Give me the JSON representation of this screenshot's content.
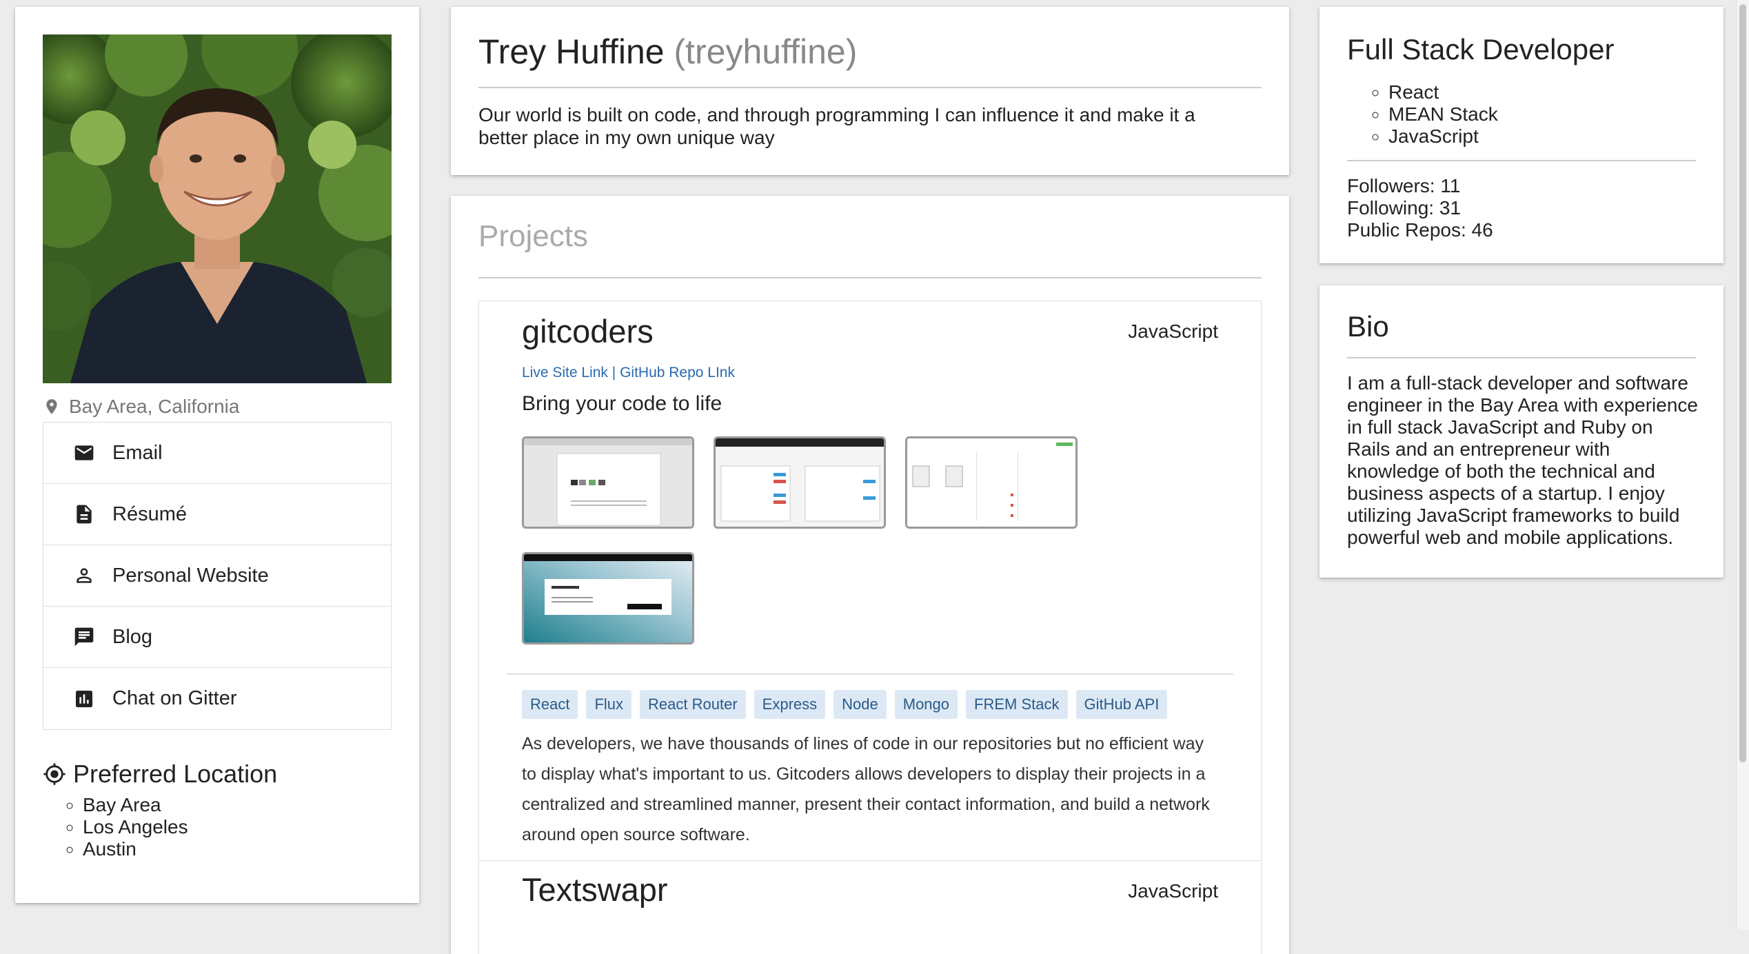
{
  "profile": {
    "name": "Trey Huffine",
    "username": "(treyhuffine)",
    "tagline": "Our world is built on code, and through programming I can influence it and make it a better place in my own unique way",
    "location": "Bay Area, California"
  },
  "links": [
    {
      "label": "Email",
      "icon": "email-icon"
    },
    {
      "label": "Résumé",
      "icon": "document-icon"
    },
    {
      "label": "Personal Website",
      "icon": "person-icon"
    },
    {
      "label": "Blog",
      "icon": "chat-bubble-icon"
    },
    {
      "label": "Chat on Gitter",
      "icon": "bar-chart-icon"
    }
  ],
  "preferred_location": {
    "title": "Preferred Location",
    "items": [
      "Bay Area",
      "Los Angeles",
      "Austin"
    ]
  },
  "projects": {
    "title": "Projects",
    "items": [
      {
        "name": "gitcoders",
        "language": "JavaScript",
        "live_link": "Live Site Link",
        "separator": "|",
        "repo_link": "GitHub Repo LInk",
        "tagline": "Bring your code to life",
        "tags": [
          "React",
          "Flux",
          "React Router",
          "Express",
          "Node",
          "Mongo",
          "FREM Stack",
          "GitHub API"
        ],
        "description": "As developers, we have thousands of lines of code in our repositories but no efficient way to display what's important to us. Gitcoders allows developers to display their projects in a centralized and streamlined manner, present their contact information, and build a network around open source software."
      },
      {
        "name": "Textswapr",
        "language": "JavaScript"
      }
    ]
  },
  "role": {
    "title": "Full Stack Developer",
    "skills": [
      "React",
      "MEAN Stack",
      "JavaScript"
    ],
    "followers": "Followers: 11",
    "following": "Following: 31",
    "public_repos": "Public Repos: 46"
  },
  "bio": {
    "title": "Bio",
    "text": "I am a full-stack developer and software engineer in the Bay Area with experience in full stack JavaScript and Ruby on Rails and an entrepreneur with knowledge of both the technical and business aspects of a startup. I enjoy utilizing JavaScript frameworks to build powerful web and mobile applications."
  },
  "colors": {
    "page_background": "#ececec",
    "link_blue": "#2a6ab0",
    "tag_background": "#dce9f5",
    "tag_text": "#2b5a86"
  }
}
